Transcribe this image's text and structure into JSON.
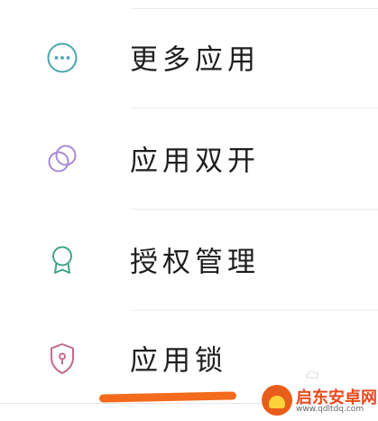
{
  "menu": {
    "items": [
      {
        "label": "更多应用",
        "icon": "more-circle-icon",
        "color": "#4aa6ad"
      },
      {
        "label": "应用双开",
        "icon": "dual-app-icon",
        "color": "#a98ad8"
      },
      {
        "label": "授权管理",
        "icon": "award-badge-icon",
        "color": "#3fa58a"
      },
      {
        "label": "应用锁",
        "icon": "shield-lock-icon",
        "color": "#c46b86"
      }
    ]
  },
  "watermark": {
    "title": "启东安卓网",
    "url": "www.qdltdq.com",
    "color": "#e8491a"
  },
  "highlight_color": "#f36b1c"
}
